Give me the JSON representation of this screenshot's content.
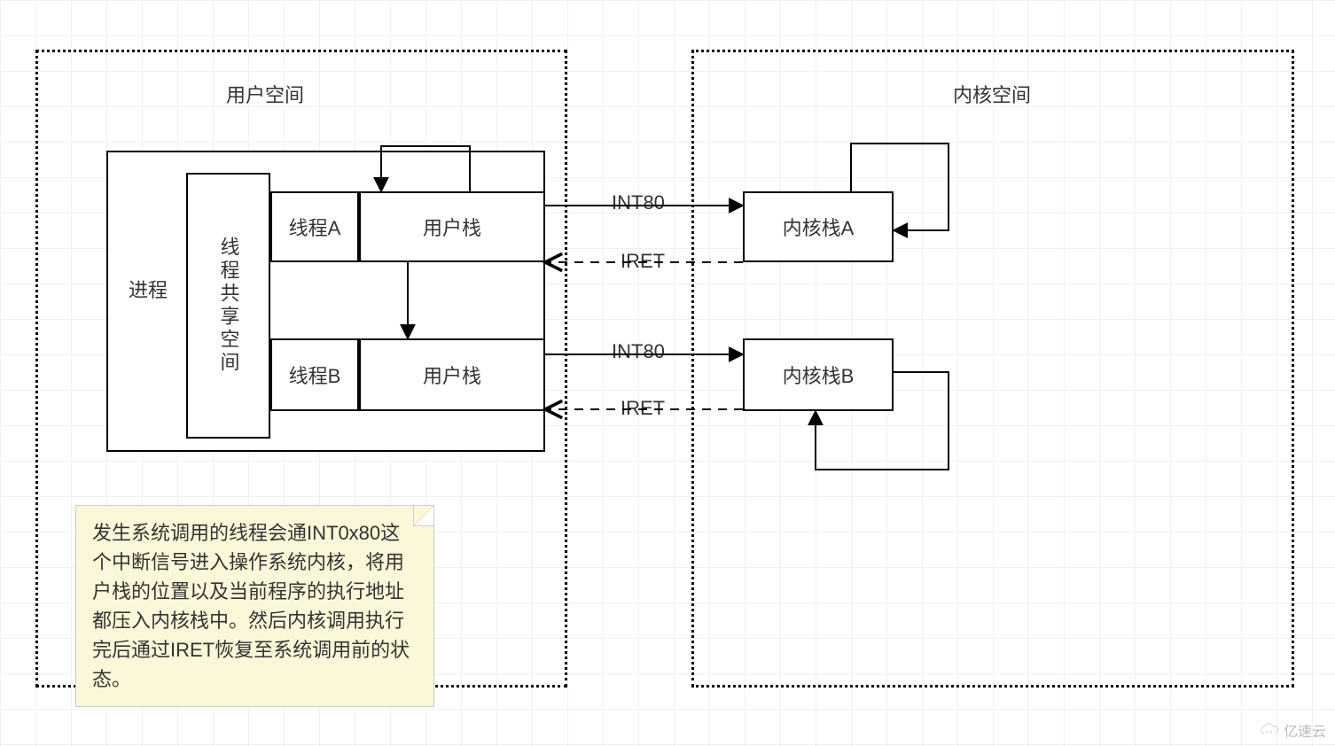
{
  "user_space_title": "用户空间",
  "kernel_space_title": "内核空间",
  "process_label": "进程",
  "thread_shared_space": "线程共享空间",
  "thread_a": "线程A",
  "thread_b": "线程B",
  "user_stack": "用户栈",
  "kernel_stack_a": "内核栈A",
  "kernel_stack_b": "内核栈B",
  "int80": "INT80",
  "iret": "IRET",
  "note_text": "发生系统调用的线程会通INT0x80这个中断信号进入操作系统内核，将用户栈的位置以及当前程序的执行地址都压入内核栈中。然后内核调用执行完后通过IRET恢复至系统调用前的状态。",
  "watermark": "亿速云"
}
